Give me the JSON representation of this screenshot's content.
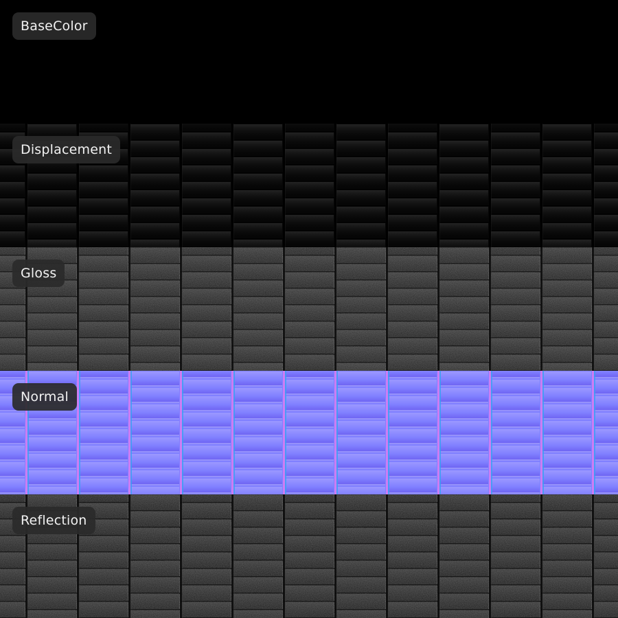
{
  "maps": [
    {
      "id": "basecolor",
      "label": "BaseColor",
      "style": "solid",
      "colors": {
        "base": "#000000"
      }
    },
    {
      "id": "displacement",
      "label": "Displacement",
      "style": "height",
      "colors": {
        "base": "#070707",
        "light": "#262626",
        "dark": "#000000"
      }
    },
    {
      "id": "gloss",
      "label": "Gloss",
      "style": "rough",
      "colors": {
        "base": "#2c2c2c",
        "light": "#464646",
        "dark": "#0c0c0c"
      }
    },
    {
      "id": "normal",
      "label": "Normal",
      "style": "normal",
      "colors": {
        "base": "#8080ff",
        "top": "#9b98ff",
        "bottom": "#6b5ef0",
        "pink": "#d97cf2",
        "cyan": "#3aa0f2",
        "seam": "#a6a6ff"
      }
    },
    {
      "id": "reflection",
      "label": "Reflection",
      "style": "rough",
      "colors": {
        "base": "#282828",
        "light": "#424242",
        "dark": "#0a0a0a"
      }
    }
  ]
}
